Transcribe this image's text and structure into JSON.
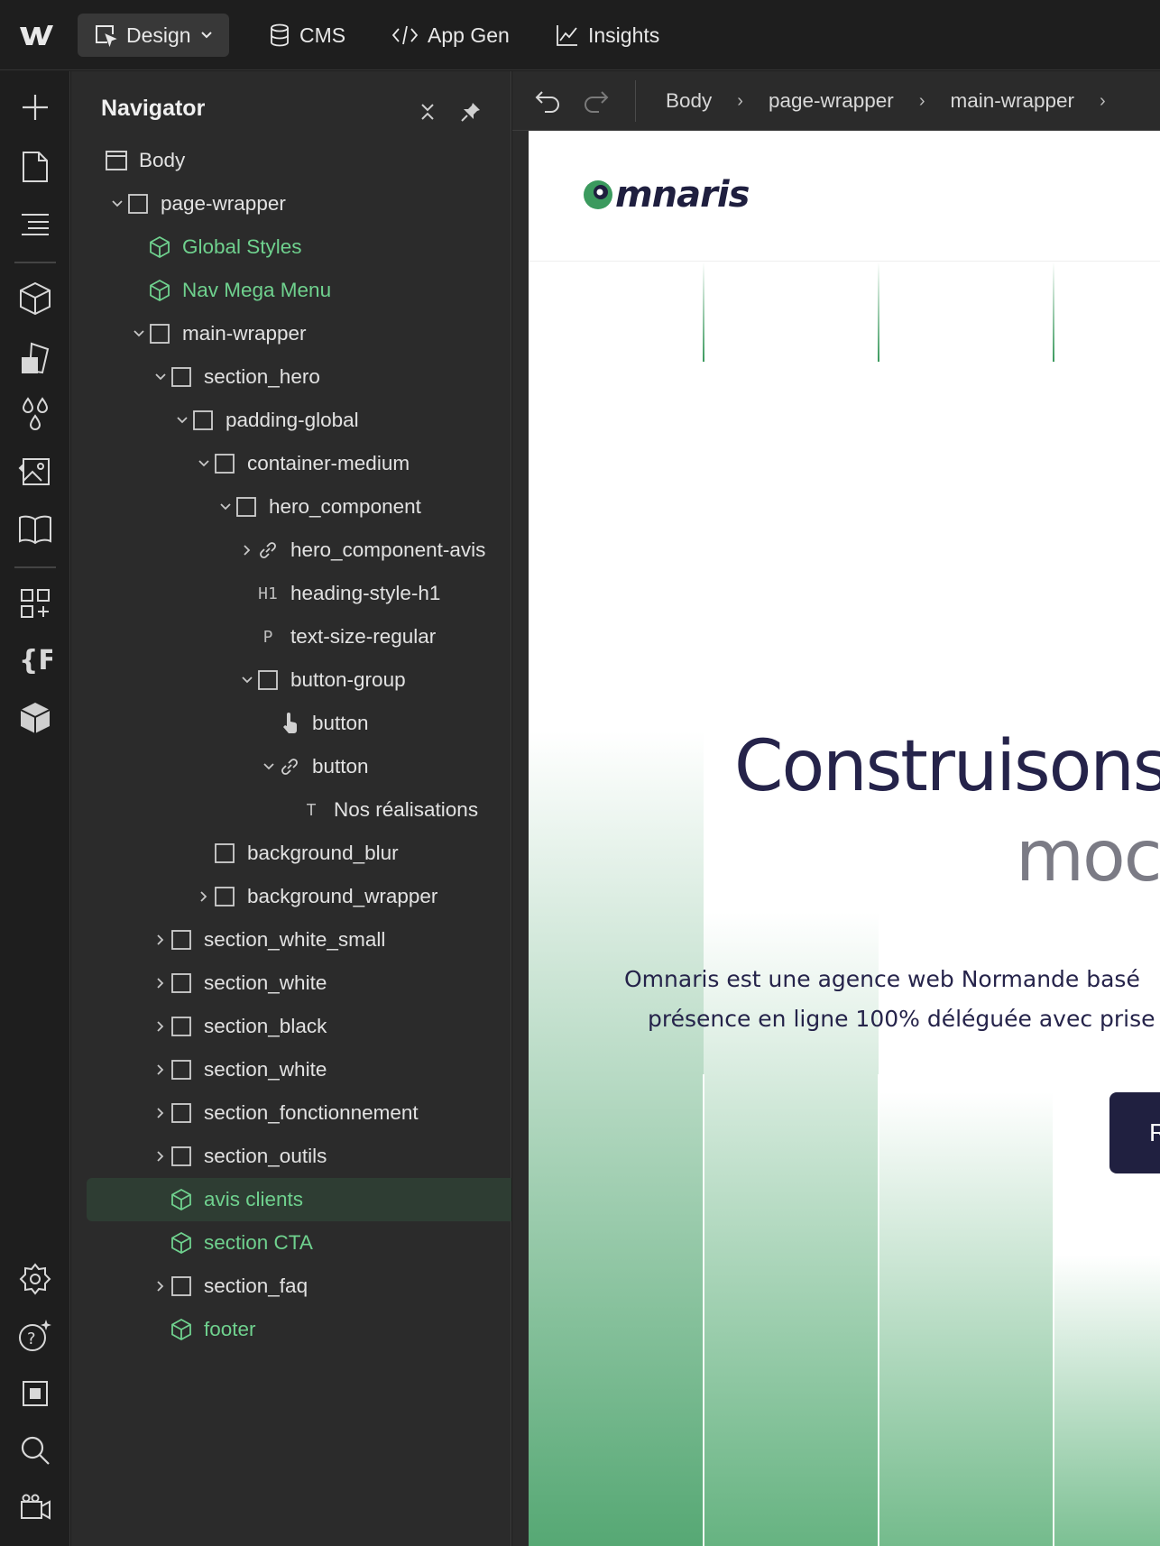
{
  "topbar": {
    "modes": [
      {
        "label": "Design",
        "icon": "cursor-frame-icon",
        "active": true
      },
      {
        "label": "CMS",
        "icon": "database-icon"
      },
      {
        "label": "App Gen",
        "icon": "code-icon"
      },
      {
        "label": "Insights",
        "icon": "chart-line-icon"
      }
    ]
  },
  "leftbar": {
    "top_icons": [
      "plus-icon",
      "page-icon",
      "navigator-icon",
      "components-icon",
      "style-selector-icon",
      "variables-icon",
      "assets-icon",
      "book-icon",
      "apps-icon",
      "finsweet-icon",
      "package-icon"
    ],
    "bottom_icons": [
      "settings-icon",
      "help-icon",
      "stop-icon",
      "search-icon",
      "video-icon"
    ]
  },
  "navigator": {
    "title": "Navigator",
    "tree": [
      {
        "label": "Body",
        "depth": 0,
        "icon": "body",
        "chev": "none"
      },
      {
        "label": "page-wrapper",
        "depth": 1,
        "icon": "box",
        "chev": "down"
      },
      {
        "label": "Global Styles",
        "depth": 2,
        "icon": "component",
        "chev": "none"
      },
      {
        "label": "Nav Mega Menu",
        "depth": 2,
        "icon": "component",
        "chev": "none"
      },
      {
        "label": "main-wrapper",
        "depth": 2,
        "icon": "box",
        "chev": "down"
      },
      {
        "label": "section_hero",
        "depth": 3,
        "icon": "box",
        "chev": "down"
      },
      {
        "label": "padding-global",
        "depth": 4,
        "icon": "box",
        "chev": "down"
      },
      {
        "label": "container-medium",
        "depth": 5,
        "icon": "box",
        "chev": "down"
      },
      {
        "label": "hero_component",
        "depth": 6,
        "icon": "box",
        "chev": "down"
      },
      {
        "label": "hero_component-avis",
        "depth": 7,
        "icon": "link",
        "chev": "right"
      },
      {
        "label": "heading-style-h1",
        "depth": 7,
        "icon": "h1",
        "chev": "none"
      },
      {
        "label": "text-size-regular",
        "depth": 7,
        "icon": "p",
        "chev": "none"
      },
      {
        "label": "button-group",
        "depth": 7,
        "icon": "box",
        "chev": "down"
      },
      {
        "label": "button",
        "depth": 8,
        "icon": "pointer",
        "chev": "none"
      },
      {
        "label": "button",
        "depth": 8,
        "icon": "link",
        "chev": "down"
      },
      {
        "label": "Nos réalisations",
        "depth": 9,
        "icon": "t",
        "chev": "none"
      },
      {
        "label": "background_blur",
        "depth": 5,
        "icon": "box",
        "chev": "none"
      },
      {
        "label": "background_wrapper",
        "depth": 5,
        "icon": "box",
        "chev": "right"
      },
      {
        "label": "section_white_small",
        "depth": 3,
        "icon": "box",
        "chev": "right"
      },
      {
        "label": "section_white",
        "depth": 3,
        "icon": "box",
        "chev": "right"
      },
      {
        "label": "section_black",
        "depth": 3,
        "icon": "box",
        "chev": "right"
      },
      {
        "label": "section_white",
        "depth": 3,
        "icon": "box",
        "chev": "right"
      },
      {
        "label": "section_fonctionnement",
        "depth": 3,
        "icon": "box",
        "chev": "right"
      },
      {
        "label": "section_outils",
        "depth": 3,
        "icon": "box",
        "chev": "right"
      },
      {
        "label": "avis clients",
        "depth": 3,
        "icon": "component",
        "chev": "none",
        "selected": true
      },
      {
        "label": "section CTA",
        "depth": 3,
        "icon": "component",
        "chev": "none"
      },
      {
        "label": "section_faq",
        "depth": 3,
        "icon": "box",
        "chev": "right"
      },
      {
        "label": "footer",
        "depth": 3,
        "icon": "component",
        "chev": "none"
      }
    ]
  },
  "breadcrumb": [
    "Body",
    "page-wrapper",
    "main-wrapper"
  ],
  "site": {
    "brand": "mnaris",
    "hero_title_line1": "Construisons",
    "hero_title_line2": "moc",
    "hero_text_line1": "Omnaris est une agence web Normande basé",
    "hero_text_line2": "présence en ligne 100% déléguée avec prise",
    "hero_button": "R"
  },
  "colors": {
    "component_green": "#6fd18e",
    "selected_row": "#2e3d33",
    "brand_navy": "#25234a",
    "hero_green": "#56a874"
  }
}
